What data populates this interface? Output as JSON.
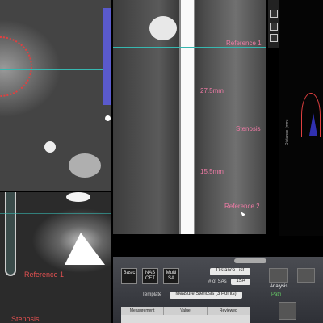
{
  "curved_view": {
    "labels": {
      "reference1": "Reference 1",
      "length1": "27.5mm",
      "stenosis": "Stenosis",
      "length2": "15.5mm",
      "reference2": "Reference 2"
    }
  },
  "axial_view": {
    "reference1": "Reference 1",
    "stenosis": "Stenosis"
  },
  "graph": {
    "ylabel": "Distance (mm)"
  },
  "controls": {
    "basic": "Basic",
    "nascet": "NAS CET",
    "multi": "Multi SA",
    "distance_list": "Distance List",
    "num_of_sas_label": "# of SAs",
    "num_of_sas_value": "1SA",
    "template_label": "Template",
    "template_value": "Measure Stenosis (3 Points)",
    "analysis": "Analysis",
    "path": "Path",
    "table_headers": [
      "Measurement",
      "Value",
      "Reviewed"
    ]
  },
  "colors": {
    "reference_line": "#37b7b0",
    "stenosis_line": "#c44ca0",
    "reference2_line": "#c8c832",
    "label_pink": "#ef7aa5",
    "label_red": "#e05050"
  }
}
